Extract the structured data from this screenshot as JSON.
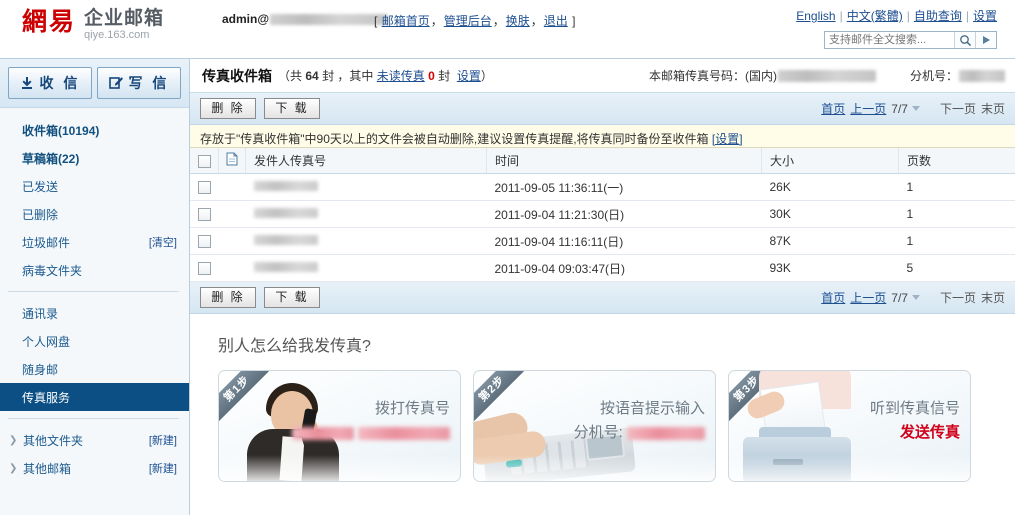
{
  "header": {
    "logo_mark": "網易",
    "logo_title": "企业邮箱",
    "logo_sub": "qiye.163.com",
    "account_prefix": "admin@",
    "links_open": "[",
    "links_close": "]",
    "links": [
      {
        "label": "邮箱首页"
      },
      {
        "label": "管理后台"
      },
      {
        "label": "换肤"
      },
      {
        "label": "退出"
      }
    ],
    "lang_links": [
      {
        "label": "English"
      },
      {
        "label": "中文(繁體)"
      },
      {
        "label": "自助查询"
      },
      {
        "label": "设置"
      }
    ],
    "search_placeholder": "支持邮件全文搜索...",
    "search_value": "",
    "search_icon": "search-icon",
    "search_go_icon": "triangle-right-icon"
  },
  "sidebar": {
    "receive_button": "收 信",
    "compose_button": "写 信",
    "receive_icon": "download-icon",
    "compose_icon": "pencil-note-icon",
    "folders": [
      {
        "label": "收件箱(10194)",
        "bold": true,
        "action": "",
        "active": false,
        "caret": false
      },
      {
        "label": "草稿箱(22)",
        "bold": true,
        "action": "",
        "active": false,
        "caret": false
      },
      {
        "label": "已发送",
        "bold": false,
        "action": "",
        "active": false,
        "caret": false
      },
      {
        "label": "已删除",
        "bold": false,
        "action": "",
        "active": false,
        "caret": false
      },
      {
        "label": "垃圾邮件",
        "bold": false,
        "action": "[清空]",
        "active": false,
        "caret": false
      },
      {
        "label": "病毒文件夹",
        "bold": false,
        "action": "",
        "active": false,
        "caret": false
      }
    ],
    "apps": [
      {
        "label": "通讯录",
        "active": false
      },
      {
        "label": "个人网盘",
        "active": false
      },
      {
        "label": "随身邮",
        "active": false
      },
      {
        "label": "传真服务",
        "active": true
      }
    ],
    "groups": [
      {
        "label": "其他文件夹",
        "action": "[新建]"
      },
      {
        "label": "其他邮箱",
        "action": "[新建]"
      }
    ]
  },
  "main": {
    "title": "传真收件箱",
    "count_prefix": "（共",
    "count_total": "64",
    "count_unit1": "封 ，其中",
    "unread_label": "未读传真",
    "unread_count": "0",
    "count_unit2": "封",
    "settings_link": "设置",
    "count_suffix": "）",
    "fax_number_label": "本邮箱传真号码：(国内)",
    "extension_label": "分机号：",
    "toolbar": {
      "delete_button": "删 除",
      "download_button": "下 载"
    },
    "pager": {
      "first": "首页",
      "prev": "上一页",
      "position": "7/7",
      "next": "下一页",
      "last": "末页"
    },
    "notice": {
      "text": "存放于\"传真收件箱\"中90天以上的文件会被自动删除,建议设置传真提醒,将传真同时备份至收件箱",
      "link": "[设置]"
    },
    "table": {
      "columns": [
        "",
        "",
        "发件人传真号",
        "时间",
        "大小",
        "页数"
      ],
      "rows": [
        {
          "sender": "",
          "time": "2011-09-05 11:36:11(一)",
          "size": "26K",
          "pages": "1"
        },
        {
          "sender": "",
          "time": "2011-09-04 11:21:30(日)",
          "size": "30K",
          "pages": "1"
        },
        {
          "sender": "",
          "time": "2011-09-04 11:16:11(日)",
          "size": "87K",
          "pages": "1"
        },
        {
          "sender": "",
          "time": "2011-09-04 09:03:47(日)",
          "size": "93K",
          "pages": "5"
        }
      ]
    }
  },
  "promo": {
    "heading": "别人怎么给我发传真?",
    "cards": [
      {
        "step": "第1步",
        "line1": "拨打传真号",
        "line2": "",
        "line2_red": false,
        "photo": "woman-on-phone"
      },
      {
        "step": "第2步",
        "line1": "按语音提示输入",
        "line2": "分机号:",
        "line2_red": false,
        "photo": "finger-on-keypad"
      },
      {
        "step": "第3步",
        "line1": "听到传真信号",
        "line2": "发送传真",
        "line2_red": true,
        "photo": "fax-machine"
      }
    ]
  },
  "colors": {
    "link": "#1d4f91",
    "accent": "#0b4f84",
    "danger": "#d40000",
    "notice_bg": "#fffde8"
  }
}
